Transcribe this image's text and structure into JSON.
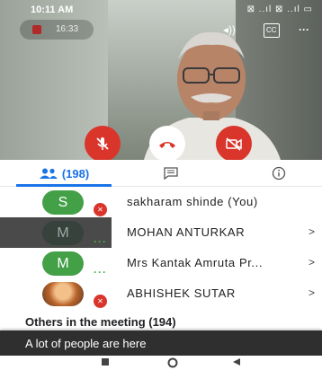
{
  "status_bar": {
    "time": "10:11 AM",
    "icons": "⊠ ..ıl ⊠ ..ıl ▭"
  },
  "call": {
    "timer": "16:33"
  },
  "controls": {
    "mic": "mic-off",
    "hangup": "end-call",
    "camera": "camera-off"
  },
  "tabs": [
    {
      "name": "people",
      "count": "(198)"
    },
    {
      "name": "chat"
    },
    {
      "name": "info"
    }
  ],
  "participants": [
    {
      "initial": "S",
      "name": "sakharam shinde (You)",
      "status": "muted"
    },
    {
      "initial": "M",
      "name": "MOHAN ANTURKAR",
      "status": "speaking"
    },
    {
      "initial": "M",
      "name": "Mrs Kantak Amruta Pr...",
      "status": "speaking"
    },
    {
      "initial": "",
      "name": "ABHISHEK SUTAR",
      "status": "muted"
    }
  ],
  "others_heading": "Others in the meeting (194)",
  "toast": "A lot of people are here"
}
